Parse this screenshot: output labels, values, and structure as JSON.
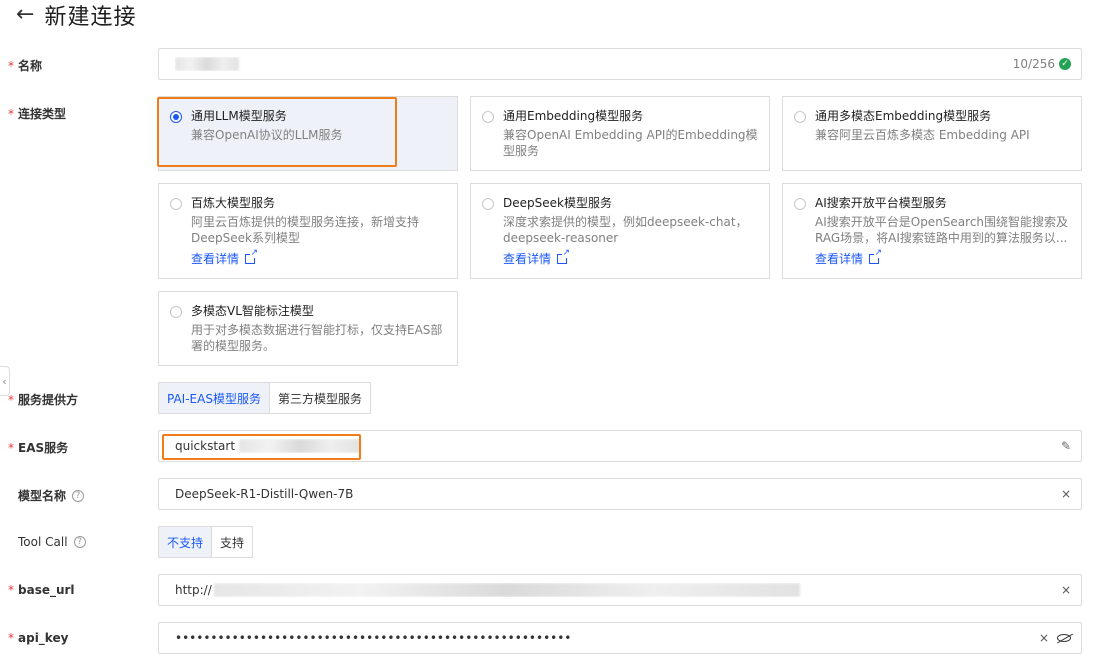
{
  "header": {
    "back_icon": "←",
    "title": "新建连接"
  },
  "form": {
    "name": {
      "label": "名称",
      "counter": "10/256"
    },
    "connection_type": {
      "label": "连接类型",
      "options": [
        {
          "title": "通用LLM模型服务",
          "desc": "兼容OpenAI协议的LLM服务",
          "link": ""
        },
        {
          "title": "通用Embedding模型服务",
          "desc": "兼容OpenAI Embedding API的Embedding模型服务",
          "link": ""
        },
        {
          "title": "通用多模态Embedding模型服务",
          "desc": "兼容阿里云百炼多模态 Embedding API",
          "link": ""
        },
        {
          "title": "百炼大模型服务",
          "desc": "阿里云百炼提供的模型服务连接，新增支持DeepSeek系列模型",
          "link": "查看详情"
        },
        {
          "title": "DeepSeek模型服务",
          "desc": "深度求索提供的模型，例如deepseek-chat，deepseek-reasoner",
          "link": "查看详情"
        },
        {
          "title": "AI搜索开放平台模型服务",
          "desc": "AI搜索开放平台是OpenSearch围绕智能搜索及RAG场景，将AI搜索链路中用到的算法服务以...",
          "link": "查看详情"
        },
        {
          "title": "多模态VL智能标注模型",
          "desc": "用于对多模态数据进行智能打标，仅支持EAS部署的模型服务。",
          "link": ""
        }
      ],
      "selected_index": 0
    },
    "provider": {
      "label": "服务提供方",
      "options": [
        "PAI-EAS模型服务",
        "第三方模型服务"
      ],
      "selected": "PAI-EAS模型服务"
    },
    "eas_service": {
      "label": "EAS服务",
      "value": "quickstart"
    },
    "model_name": {
      "label": "模型名称",
      "value": "DeepSeek-R1-Distill-Qwen-7B"
    },
    "tool_call": {
      "label": "Tool Call",
      "options": [
        "不支持",
        "支持"
      ],
      "selected": "不支持"
    },
    "base_url": {
      "label": "base_url",
      "value": "http://"
    },
    "api_key": {
      "label": "api_key",
      "value": "••••••••••••••••••••••••••••••••••••••••••••••••••••••••"
    }
  },
  "icons": {
    "check": "check-circle-icon",
    "clear": "close-icon",
    "edit": "pencil-icon",
    "eye": "eye-off-icon",
    "help": "question-circle-icon",
    "external": "external-link-icon"
  },
  "colors": {
    "accent": "#1b58f4",
    "highlight": "#f07d1a",
    "required": "#e4393c",
    "success": "#23a455"
  }
}
